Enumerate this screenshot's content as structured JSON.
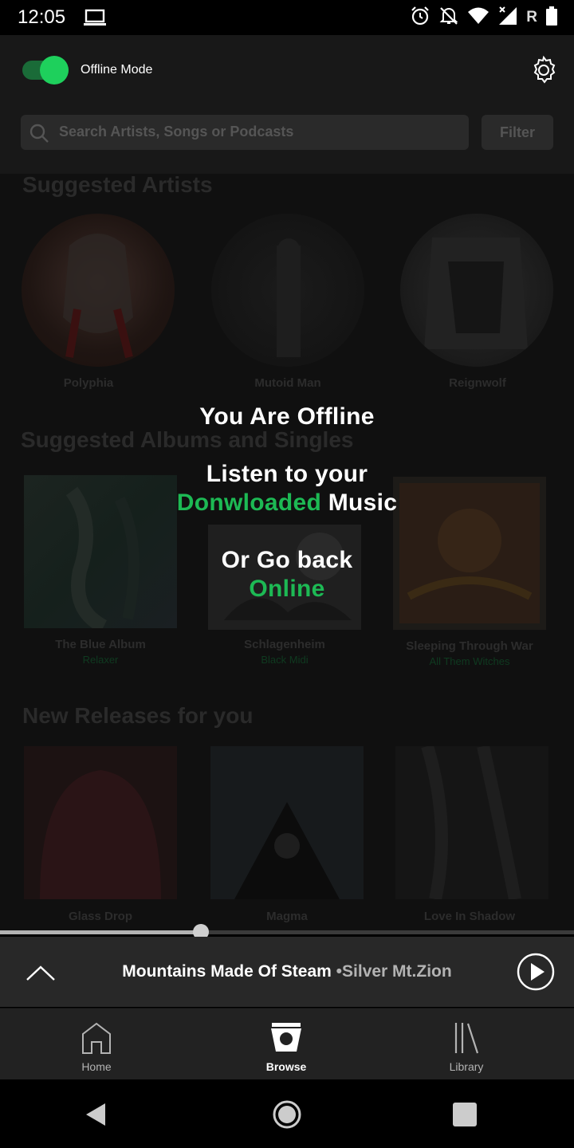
{
  "status_bar": {
    "time": "12:05",
    "icons": [
      "laptop-icon",
      "alarm-icon",
      "mute-icon",
      "wifi-icon",
      "signal-icon",
      "battery-icon"
    ],
    "roaming": "R"
  },
  "header": {
    "offline_mode_label": "Offline Mode",
    "offline_mode_on": true,
    "search_placeholder": "Search Artists, Songs or Podcasts",
    "filter_label": "Filter"
  },
  "sections": {
    "suggested_artists": {
      "title": "Suggested Artists",
      "items": [
        {
          "name": "Polyphia"
        },
        {
          "name": "Mutoid Man"
        },
        {
          "name": "Reignwolf"
        }
      ]
    },
    "suggested_albums": {
      "title": "Suggested Albums and Singles",
      "items": [
        {
          "title": "The Blue Album",
          "subtitle": "Relaxer"
        },
        {
          "title": "Schlagenheim",
          "subtitle": "Black Midi"
        },
        {
          "title": "Sleeping Through War",
          "subtitle": "All Them Witches"
        }
      ]
    },
    "new_releases": {
      "title": "New Releases for you",
      "items": [
        {
          "title": "Glass Drop"
        },
        {
          "title": "Magma"
        },
        {
          "title": "Love In Shadow"
        }
      ]
    }
  },
  "overlay": {
    "heading": "You Are Offline",
    "line1": "Listen to your",
    "line2_highlight": "Donwloaded",
    "line2_rest": "Music",
    "line3": "Or Go back",
    "line4_highlight": "Online"
  },
  "player": {
    "progress": 0.35,
    "track_title": "Mountains Made Of Steam",
    "separator": "•",
    "artist": "Silver Mt.Zion"
  },
  "bottom_nav": {
    "items": [
      {
        "label": "Home",
        "icon": "home-icon",
        "active": false
      },
      {
        "label": "Browse",
        "icon": "browse-icon",
        "active": true
      },
      {
        "label": "Library",
        "icon": "library-icon",
        "active": false
      }
    ]
  },
  "colors": {
    "accent": "#1db954",
    "toggle_knob": "#1ed05c"
  }
}
